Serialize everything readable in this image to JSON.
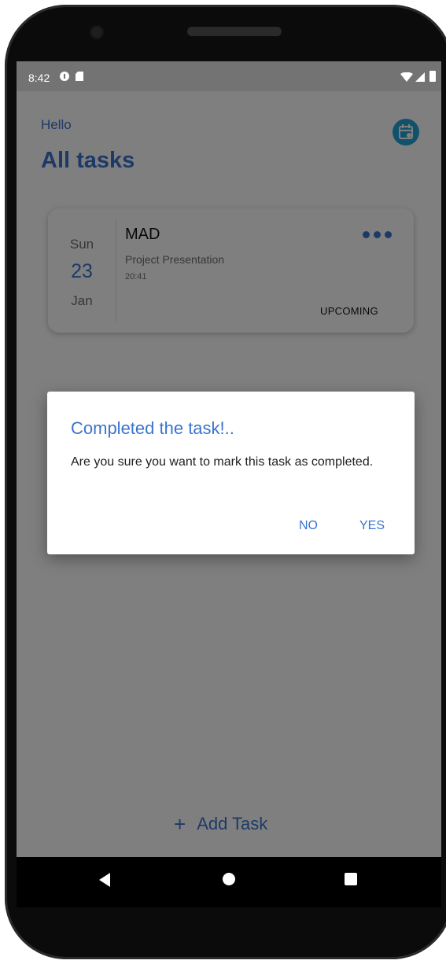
{
  "status_bar": {
    "time": "8:42",
    "icons": [
      "notification-app-icon",
      "sd-card-icon",
      "wifi-icon",
      "signal-icon",
      "battery-icon"
    ]
  },
  "header": {
    "greeting": "Hello",
    "title": "All tasks",
    "calendar_icon": "calendar-icon"
  },
  "task": {
    "day": "Sun",
    "date": "23",
    "month": "Jan",
    "title": "MAD",
    "subtitle": "Project Presentation",
    "time": "20:41",
    "status": "UPCOMING",
    "more_icon": "more-horizontal-icon"
  },
  "dialog": {
    "title": "Completed the task!..",
    "message": "Are you sure you want to mark this task as completed.",
    "no_label": "NO",
    "yes_label": "YES"
  },
  "footer": {
    "add_icon": "+",
    "add_label": "Add Task"
  },
  "colors": {
    "accent": "#3a74cf",
    "calendar_button": "#22a4d6",
    "scrim": "rgba(0,0,0,0.5)"
  }
}
